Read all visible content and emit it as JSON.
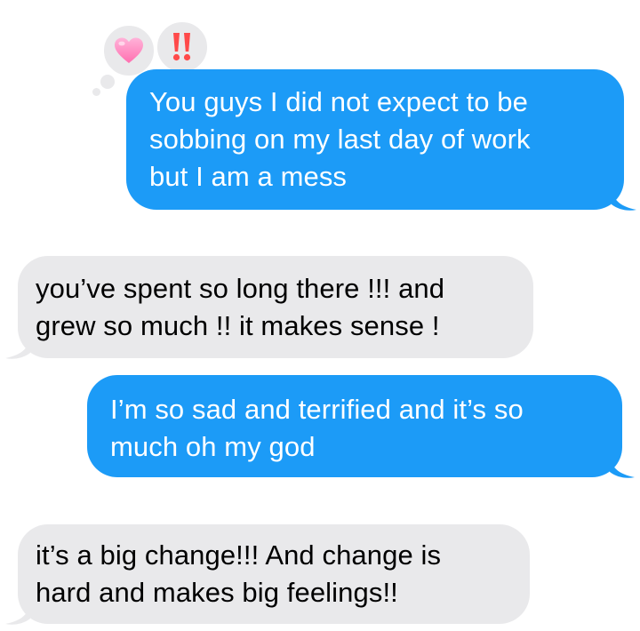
{
  "colors": {
    "sent_bubble": "#1c9bf7",
    "received_bubble": "#e9e9eb",
    "sent_text": "#ffffff",
    "received_text": "#000000",
    "heart": "#ff8fc3",
    "exclaim": "#ff4a4a"
  },
  "messages": [
    {
      "direction": "sent",
      "text": "You guys I did not expect to be\nsobbing on my last day of work\nbut I am a mess",
      "reactions": [
        "heart-icon",
        "double-exclamation-icon"
      ]
    },
    {
      "direction": "received",
      "text": "you’ve spent so long there !!! and\ngrew so much !! it makes sense !"
    },
    {
      "direction": "sent",
      "text": "I’m so sad and terrified and it’s so\nmuch oh my god"
    },
    {
      "direction": "received",
      "text": "it’s a big change!!! And change is\nhard and makes big feelings!!"
    }
  ],
  "reactions": {
    "heart": "heart-icon",
    "exclaim": "double-exclamation-icon"
  }
}
